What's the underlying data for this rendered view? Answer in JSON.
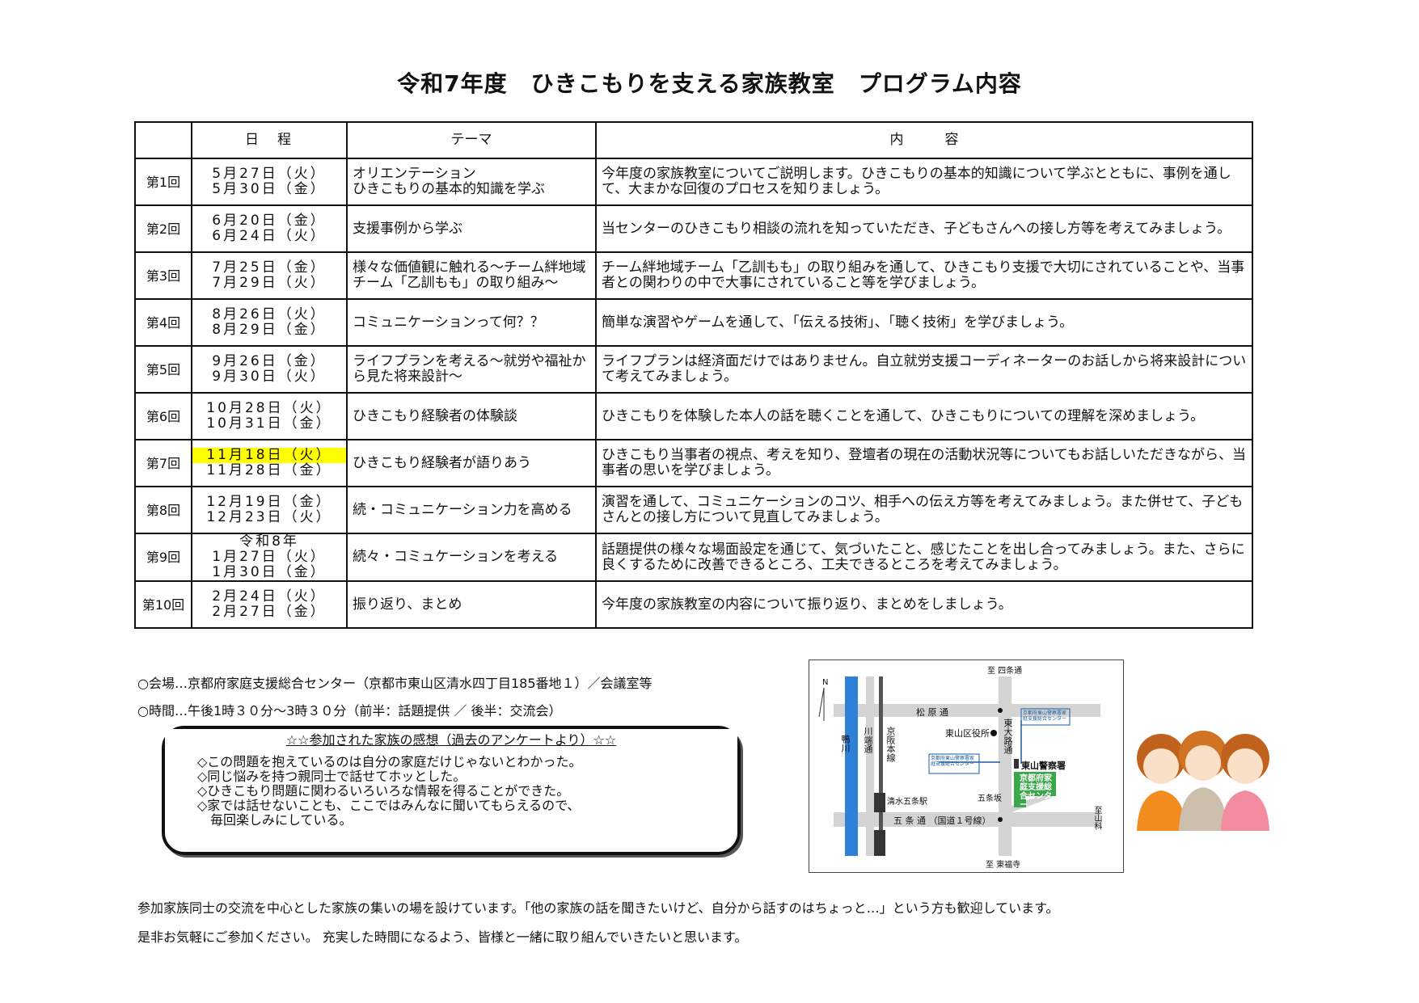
{
  "title": "令和7年度　ひきこもりを支える家族教室　プログラム内容",
  "table": {
    "headers": {
      "session": "",
      "date": "日　程",
      "theme": "テーマ",
      "content": "内　　　容"
    },
    "rows": [
      {
        "num": "第1回",
        "dates": [
          "5月27日（火）",
          "5月30日（金）"
        ],
        "theme": "オリエンテーション\nひきこもりの基本的知識を学ぶ",
        "content": "今年度の家族教室についてご説明します。ひきこもりの基本的知識について学ぶとともに、事例を通して、大まかな回復のプロセスを知りましょう。"
      },
      {
        "num": "第2回",
        "dates": [
          "6月20日（金）",
          "6月24日（火）"
        ],
        "theme": "支援事例から学ぶ",
        "content": "当センターのひきこもり相談の流れを知っていただき、子どもさんへの接し方等を考えてみましょう。"
      },
      {
        "num": "第3回",
        "dates": [
          "7月25日（金）",
          "7月29日（火）"
        ],
        "theme": "様々な価値観に触れる～チーム絆地域チーム「乙訓もも」の取り組み～",
        "content": "チーム絆地域チーム「乙訓もも」の取り組みを通して、ひきこもり支援で大切にされていることや、当事者との関わりの中で大事にされていること等を学びましょう。"
      },
      {
        "num": "第4回",
        "dates": [
          "8月26日（火）",
          "8月29日（金）"
        ],
        "theme": "コミュニケーションって何？？",
        "content": "簡単な演習やゲームを通して、「伝える技術」、「聴く技術」を学びましょう。"
      },
      {
        "num": "第5回",
        "dates": [
          "9月26日（金）",
          "9月30日（火）"
        ],
        "theme": "ライフプランを考える～就労や福祉から見た将来設計～",
        "content": "ライフプランは経済面だけではありません。自立就労支援コーディネーターのお話しから将来設計について考えてみましょう。"
      },
      {
        "num": "第6回",
        "dates": [
          "10月28日（火）",
          "10月31日（金）"
        ],
        "theme": "ひきこもり経験者の体験談",
        "content": "ひきこもりを体験した本人の話を聴くことを通して、ひきこもりについての理解を深めましょう。"
      },
      {
        "num": "第7回",
        "dates": [
          "11月18日（火）",
          "11月28日（金）"
        ],
        "theme": "ひきこもり経験者が語りあう",
        "content": "ひきこもり当事者の視点、考えを知り、登壇者の現在の活動状況等についてもお話しいただきながら、当事者の思いを学びましょう。",
        "highlight_first": true
      },
      {
        "num": "第8回",
        "dates": [
          "12月19日（金）",
          "12月23日（火）"
        ],
        "theme": "続・コミュニケーション力を高める",
        "content": "演習を通して、コミュニケーションのコツ、相手への伝え方等を考えてみましょう。また併せて、子どもさんとの接し方について見直してみましょう。"
      },
      {
        "num": "第9回",
        "dates": [
          "令和8年",
          "1月27日（火）",
          "1月30日（金）"
        ],
        "theme": "続々・コミュケーションを考える",
        "content": "話題提供の様々な場面設定を通じて、気づいたこと、感じたことを出し合ってみましょう。また、さらに良くするために改善できるところ、工夫できるところを考えてみましょう。"
      },
      {
        "num": "第10回",
        "dates": [
          "2月24日（火）",
          "2月27日（金）"
        ],
        "theme": "振り返り、まとめ",
        "content": "今年度の家族教室の内容について振り返り、まとめをしましょう。"
      }
    ]
  },
  "info": {
    "venue": "○会場…京都府家庭支援総合センター（京都市東山区清水四丁目185番地１）／会議室等",
    "time": "○時間…午後1時３０分～3時３０分（前半：話題提供 ／ 後半：交流会）"
  },
  "voices": {
    "title": "☆☆参加された家族の感想（過去のアンケートより）☆☆",
    "items": [
      "◇この問題を抱えているのは自分の家庭だけじゃないとわかった。",
      "◇同じ悩みを持つ親同士で話せてホッとした。",
      "◇ひきこもり問題に関わるいろいろな情報を得ることができた。",
      "◇家では話せないことも、ここではみんなに聞いてもらえるので、",
      "　毎回楽しみにしている。"
    ]
  },
  "map": {
    "north": "N",
    "to_shijo": "至 四条通",
    "to_tofukuji": "至 東福寺",
    "to_yamashina": "至山科",
    "matsubara": "松 原 通",
    "gojo": "五 条 通 （国道１号線）",
    "kamogawa": "鴨川",
    "kawabata": "川端通",
    "keihan": "京阪本線",
    "higashioji": "東大路通",
    "ward_office": "東山区役所",
    "police": "東山警察署",
    "kiyomizu_gojo": "清水五条駅",
    "gojozaka": "五条坂",
    "center_label": "京都府家庭支援総合センター",
    "note_left": "京都府東山警察署家庭支援総合センター",
    "note_top": "京都府東山警察署家庭支援総合センター"
  },
  "footer": {
    "line1": "参加家族同士の交流を中心とした家族の集いの場を設けています。「他の家族の話を聞きたいけど、自分から話すのはちょっと…」という方も歓迎しています。",
    "line2": "是非お気軽にご参加ください。 充実した時間になるよう、皆様と一緒に取り組んでいきたいと思います。"
  },
  "colors": {
    "highlight": "#ffff00",
    "map_green": "#3aa84a",
    "map_water": "#2f80d8"
  }
}
